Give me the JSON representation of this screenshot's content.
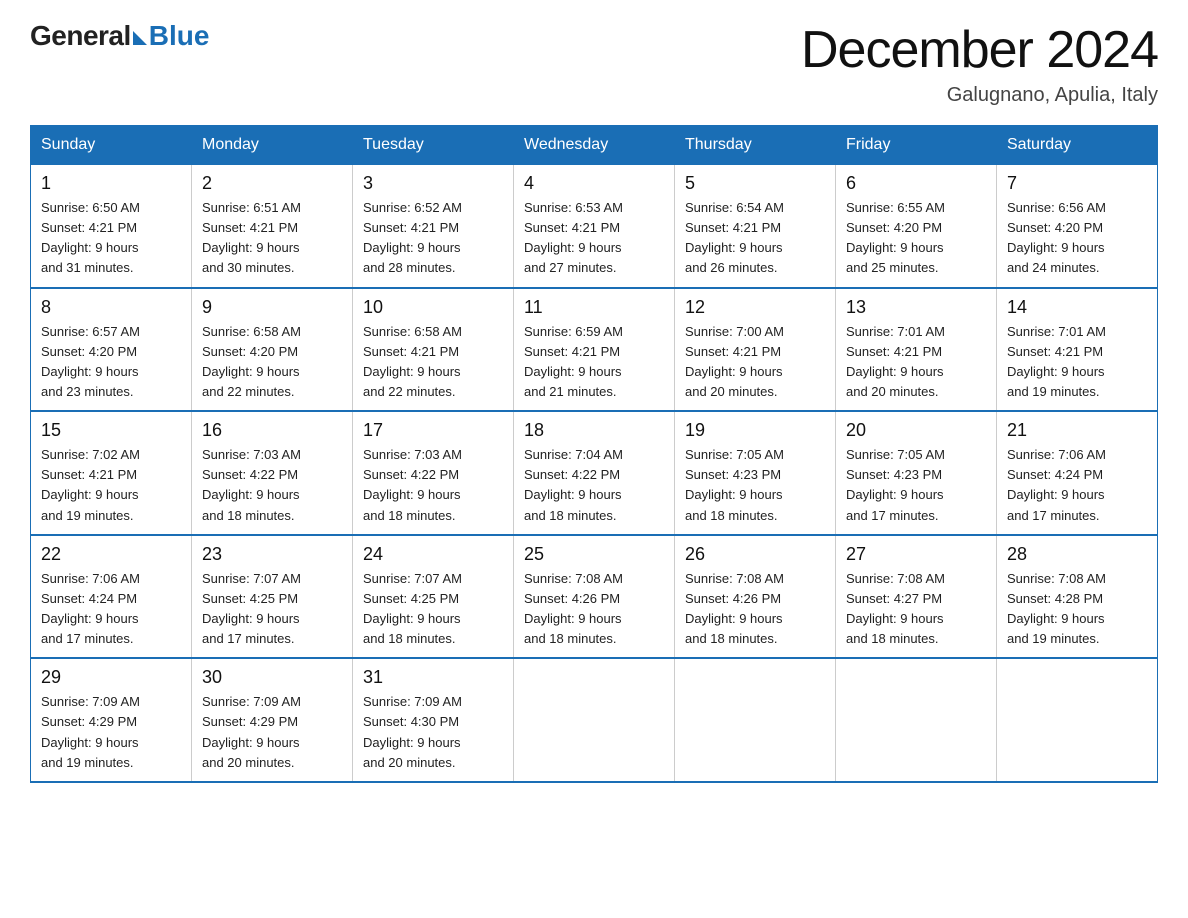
{
  "logo": {
    "general": "General",
    "blue": "Blue"
  },
  "title": "December 2024",
  "subtitle": "Galugnano, Apulia, Italy",
  "headers": [
    "Sunday",
    "Monday",
    "Tuesday",
    "Wednesday",
    "Thursday",
    "Friday",
    "Saturday"
  ],
  "weeks": [
    [
      {
        "day": "1",
        "info": "Sunrise: 6:50 AM\nSunset: 4:21 PM\nDaylight: 9 hours\nand 31 minutes."
      },
      {
        "day": "2",
        "info": "Sunrise: 6:51 AM\nSunset: 4:21 PM\nDaylight: 9 hours\nand 30 minutes."
      },
      {
        "day": "3",
        "info": "Sunrise: 6:52 AM\nSunset: 4:21 PM\nDaylight: 9 hours\nand 28 minutes."
      },
      {
        "day": "4",
        "info": "Sunrise: 6:53 AM\nSunset: 4:21 PM\nDaylight: 9 hours\nand 27 minutes."
      },
      {
        "day": "5",
        "info": "Sunrise: 6:54 AM\nSunset: 4:21 PM\nDaylight: 9 hours\nand 26 minutes."
      },
      {
        "day": "6",
        "info": "Sunrise: 6:55 AM\nSunset: 4:20 PM\nDaylight: 9 hours\nand 25 minutes."
      },
      {
        "day": "7",
        "info": "Sunrise: 6:56 AM\nSunset: 4:20 PM\nDaylight: 9 hours\nand 24 minutes."
      }
    ],
    [
      {
        "day": "8",
        "info": "Sunrise: 6:57 AM\nSunset: 4:20 PM\nDaylight: 9 hours\nand 23 minutes."
      },
      {
        "day": "9",
        "info": "Sunrise: 6:58 AM\nSunset: 4:20 PM\nDaylight: 9 hours\nand 22 minutes."
      },
      {
        "day": "10",
        "info": "Sunrise: 6:58 AM\nSunset: 4:21 PM\nDaylight: 9 hours\nand 22 minutes."
      },
      {
        "day": "11",
        "info": "Sunrise: 6:59 AM\nSunset: 4:21 PM\nDaylight: 9 hours\nand 21 minutes."
      },
      {
        "day": "12",
        "info": "Sunrise: 7:00 AM\nSunset: 4:21 PM\nDaylight: 9 hours\nand 20 minutes."
      },
      {
        "day": "13",
        "info": "Sunrise: 7:01 AM\nSunset: 4:21 PM\nDaylight: 9 hours\nand 20 minutes."
      },
      {
        "day": "14",
        "info": "Sunrise: 7:01 AM\nSunset: 4:21 PM\nDaylight: 9 hours\nand 19 minutes."
      }
    ],
    [
      {
        "day": "15",
        "info": "Sunrise: 7:02 AM\nSunset: 4:21 PM\nDaylight: 9 hours\nand 19 minutes."
      },
      {
        "day": "16",
        "info": "Sunrise: 7:03 AM\nSunset: 4:22 PM\nDaylight: 9 hours\nand 18 minutes."
      },
      {
        "day": "17",
        "info": "Sunrise: 7:03 AM\nSunset: 4:22 PM\nDaylight: 9 hours\nand 18 minutes."
      },
      {
        "day": "18",
        "info": "Sunrise: 7:04 AM\nSunset: 4:22 PM\nDaylight: 9 hours\nand 18 minutes."
      },
      {
        "day": "19",
        "info": "Sunrise: 7:05 AM\nSunset: 4:23 PM\nDaylight: 9 hours\nand 18 minutes."
      },
      {
        "day": "20",
        "info": "Sunrise: 7:05 AM\nSunset: 4:23 PM\nDaylight: 9 hours\nand 17 minutes."
      },
      {
        "day": "21",
        "info": "Sunrise: 7:06 AM\nSunset: 4:24 PM\nDaylight: 9 hours\nand 17 minutes."
      }
    ],
    [
      {
        "day": "22",
        "info": "Sunrise: 7:06 AM\nSunset: 4:24 PM\nDaylight: 9 hours\nand 17 minutes."
      },
      {
        "day": "23",
        "info": "Sunrise: 7:07 AM\nSunset: 4:25 PM\nDaylight: 9 hours\nand 17 minutes."
      },
      {
        "day": "24",
        "info": "Sunrise: 7:07 AM\nSunset: 4:25 PM\nDaylight: 9 hours\nand 18 minutes."
      },
      {
        "day": "25",
        "info": "Sunrise: 7:08 AM\nSunset: 4:26 PM\nDaylight: 9 hours\nand 18 minutes."
      },
      {
        "day": "26",
        "info": "Sunrise: 7:08 AM\nSunset: 4:26 PM\nDaylight: 9 hours\nand 18 minutes."
      },
      {
        "day": "27",
        "info": "Sunrise: 7:08 AM\nSunset: 4:27 PM\nDaylight: 9 hours\nand 18 minutes."
      },
      {
        "day": "28",
        "info": "Sunrise: 7:08 AM\nSunset: 4:28 PM\nDaylight: 9 hours\nand 19 minutes."
      }
    ],
    [
      {
        "day": "29",
        "info": "Sunrise: 7:09 AM\nSunset: 4:29 PM\nDaylight: 9 hours\nand 19 minutes."
      },
      {
        "day": "30",
        "info": "Sunrise: 7:09 AM\nSunset: 4:29 PM\nDaylight: 9 hours\nand 20 minutes."
      },
      {
        "day": "31",
        "info": "Sunrise: 7:09 AM\nSunset: 4:30 PM\nDaylight: 9 hours\nand 20 minutes."
      },
      {
        "day": "",
        "info": ""
      },
      {
        "day": "",
        "info": ""
      },
      {
        "day": "",
        "info": ""
      },
      {
        "day": "",
        "info": ""
      }
    ]
  ]
}
